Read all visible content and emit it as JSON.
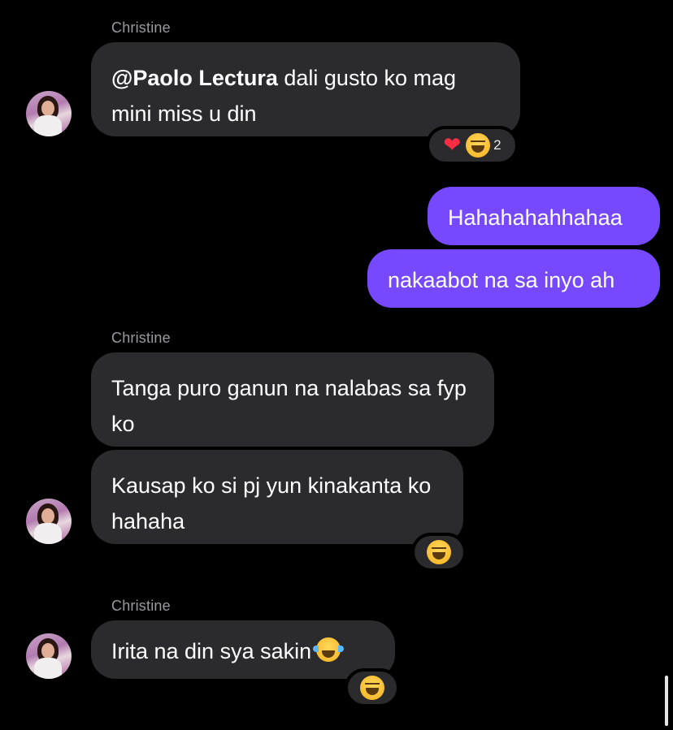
{
  "messages": [
    {
      "sender": "Christine",
      "mention": "@Paolo Lectura",
      "text_after_mention": " dali gusto ko mag mini miss u din",
      "reactions": {
        "emojis": [
          "red-heart",
          "grinning-squinting-face"
        ],
        "count": "2"
      }
    },
    {
      "from": "me",
      "text": "Hahahahahhahaa"
    },
    {
      "from": "me",
      "text": "nakaabot na sa inyo ah"
    },
    {
      "sender": "Christine",
      "text": "Tanga puro ganun na nalabas sa fyp ko"
    },
    {
      "text": "Kausap ko si pj yun kinakanta ko hahaha",
      "reactions": {
        "emojis": [
          "grinning-squinting-face"
        ]
      }
    },
    {
      "sender": "Christine",
      "text": "Irita na din sya sakin",
      "trailing_emoji": "face-with-tears-of-joy",
      "reactions": {
        "emojis": [
          "grinning-squinting-face"
        ]
      }
    }
  ],
  "colors": {
    "background": "#000000",
    "incoming_bubble": "#2b2b2d",
    "outgoing_bubble": "#7649fe",
    "sender_label": "#9a9a9f"
  }
}
